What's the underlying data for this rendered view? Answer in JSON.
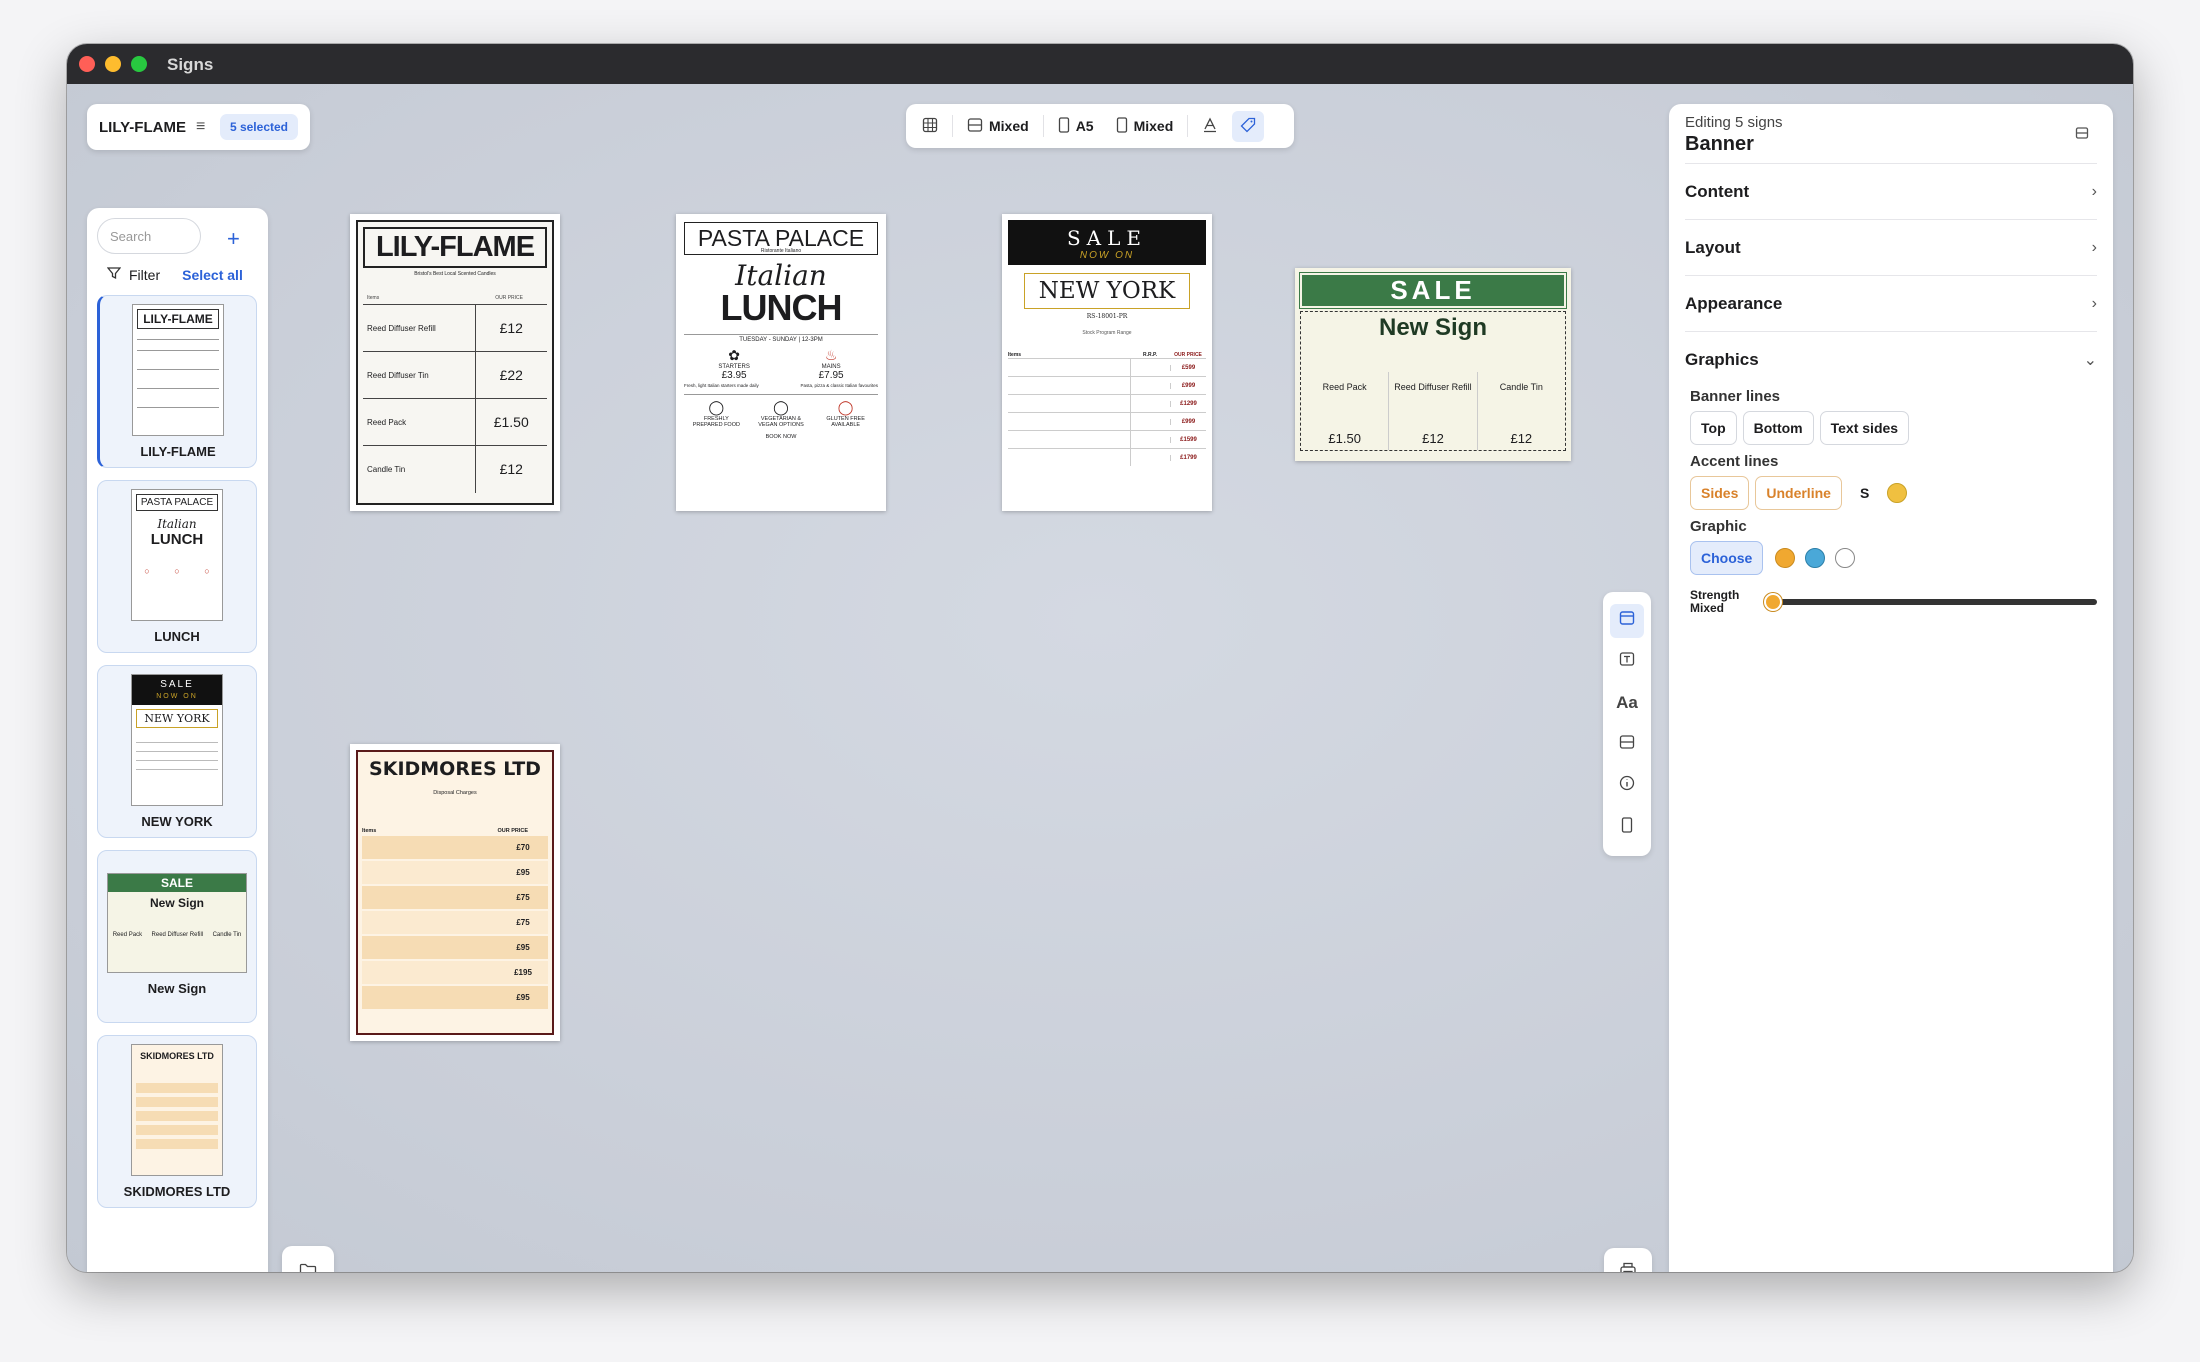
{
  "window": {
    "title": "Signs",
    "lights": [
      "#ff5f57",
      "#febc2e",
      "#28c840"
    ]
  },
  "project": {
    "name": "LILY-FLAME",
    "selected": "5 selected"
  },
  "sidebar": {
    "search_placeholder": "Search",
    "filter_label": "Filter",
    "select_all": "Select all",
    "items": [
      {
        "label": "LILY-FLAME"
      },
      {
        "label": "LUNCH"
      },
      {
        "label": "NEW YORK"
      },
      {
        "label": "New Sign"
      },
      {
        "label": "SKIDMORES LTD"
      }
    ]
  },
  "toolbar": {
    "mixed1": "Mixed",
    "size": "A5",
    "mixed2": "Mixed"
  },
  "signs": {
    "lily": {
      "title": "LILY-FLAME",
      "subtitle": "Bristol's Best Local Scented Candles",
      "col_items": "Items",
      "col_price": "OUR PRICE",
      "rows": [
        {
          "name": "Reed Diffuser Refill",
          "price": "£12"
        },
        {
          "name": "Reed Diffuser Tin",
          "price": "£22"
        },
        {
          "name": "Reed Pack",
          "price": "£1.50"
        },
        {
          "name": "Candle Tin",
          "price": "£12"
        }
      ]
    },
    "pasta": {
      "title": "PASTA PALACE",
      "sub": "Ristorante Italiano",
      "italian": "Italian",
      "lunch": "LUNCH",
      "hours": "TUESDAY - SUNDAY | 12-3PM",
      "starters": "STARTERS",
      "starters_price": "£3.95",
      "mains": "MAINS",
      "mains_price": "£7.95",
      "desc1": "Fresh, light Italian starters made daily",
      "desc2": "Pasta, pizza & classic Italian favourites",
      "f1": "FRESHLY PREPARED FOOD",
      "f2": "VEGETARIAN & VEGAN OPTIONS",
      "f3": "GLUTEN FREE AVAILABLE",
      "book": "BOOK NOW"
    },
    "ny": {
      "sale": "SALE",
      "nowon": "NOW ON",
      "title": "NEW YORK",
      "code": "RS-18001-PR",
      "subline": "Stock Program Range",
      "col_items": "Items",
      "col_rrp": "R.R.P.",
      "col_price": "OUR PRICE",
      "prices": [
        "£599",
        "£999",
        "£1299",
        "£999",
        "£1599",
        "£1799"
      ]
    },
    "newsign": {
      "banner": "SALE",
      "title": "New Sign",
      "cols": [
        {
          "name": "Reed Pack",
          "price": "£1.50"
        },
        {
          "name": "Reed Diffuser Refill",
          "price": "£12"
        },
        {
          "name": "Candle Tin",
          "price": "£12"
        }
      ]
    },
    "skid": {
      "title": "SKIDMORES LTD",
      "sub": "Disposal Charges",
      "col_items": "Items",
      "col_price": "OUR PRICE",
      "prices": [
        "£70",
        "£95",
        "£75",
        "£75",
        "£95",
        "£195",
        "£95"
      ]
    }
  },
  "panel": {
    "subtitle": "Editing 5 signs",
    "title": "Banner",
    "sections": {
      "content": "Content",
      "layout": "Layout",
      "appearance": "Appearance",
      "graphics": "Graphics"
    },
    "banner_lines": "Banner lines",
    "top": "Top",
    "bottom": "Bottom",
    "text_sides": "Text sides",
    "accent_lines": "Accent lines",
    "sides": "Sides",
    "underline": "Underline",
    "size_s": "S",
    "graphic": "Graphic",
    "choose": "Choose",
    "strength": "Strength",
    "strength_value": "Mixed"
  },
  "colors": {
    "accent": "#2c62d8",
    "orange": "#f0a830",
    "blue": "#4aa8d8",
    "green": "#3b7a47",
    "cream": "#fbead0"
  }
}
